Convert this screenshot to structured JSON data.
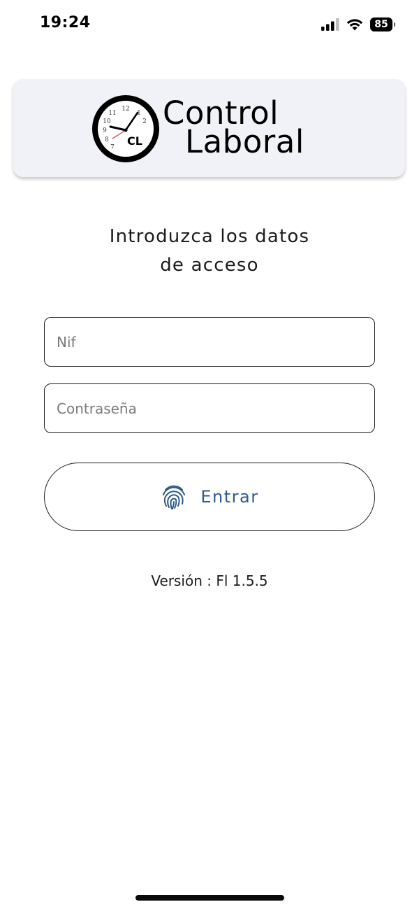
{
  "status_bar": {
    "time": "19:24",
    "battery_level": "85",
    "icons": [
      "signal-icon",
      "wifi-icon",
      "battery-icon"
    ]
  },
  "logo": {
    "line1": "Control",
    "line2": "Laboral",
    "badge": "CL",
    "icon": "clock-icon"
  },
  "login": {
    "prompt_line1": "Introduzca los datos",
    "prompt_line2": "de acceso",
    "nif_placeholder": "Nif",
    "nif_value": "",
    "password_placeholder": "Contraseña",
    "password_value": "",
    "button_label": "Entrar",
    "button_icon": "fingerprint-icon",
    "accent_color": "#2e5a8e"
  },
  "footer": {
    "version": "Versión : Fl 1.5.5"
  }
}
